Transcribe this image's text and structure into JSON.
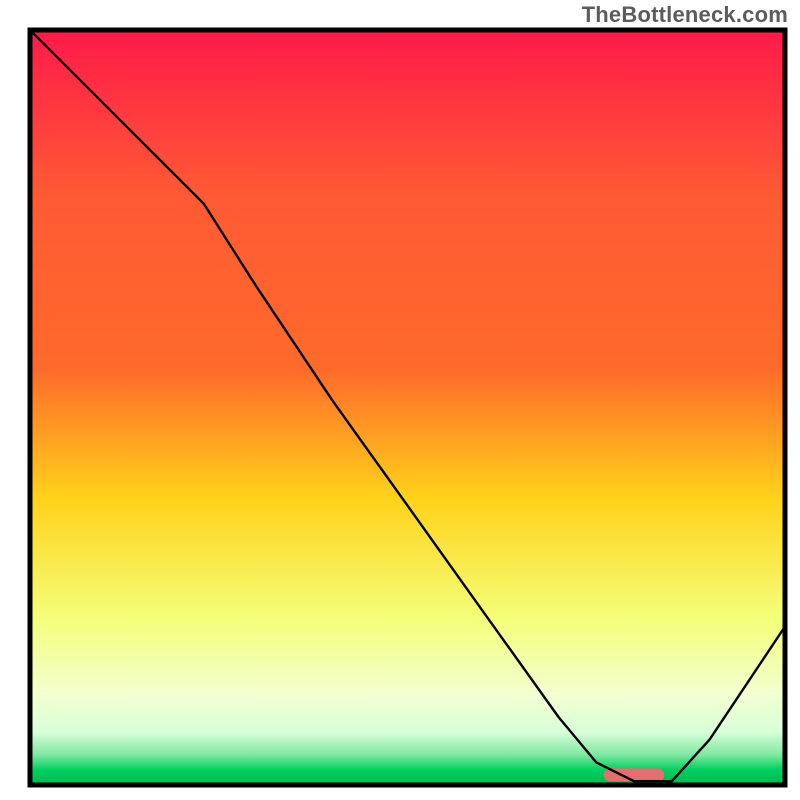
{
  "watermark": "TheBottleneck.com",
  "colors": {
    "border": "#000000",
    "curve": "#000000",
    "marker_fill": "#e17070",
    "grad_top": "#ff1a4a",
    "grad_upper": "#ff6a2a",
    "grad_mid": "#ffd21a",
    "grad_lower": "#f4ff7a",
    "grad_pale": "#f2ffd0",
    "grad_green": "#00d060",
    "grad_green2": "#00b850"
  },
  "chart_data": {
    "type": "line",
    "title": "",
    "xlabel": "",
    "ylabel": "",
    "xlim": [
      0,
      100
    ],
    "ylim": [
      0,
      100
    ],
    "x": [
      0,
      8,
      18,
      23,
      30,
      40,
      50,
      60,
      70,
      75,
      80,
      85,
      90,
      100
    ],
    "values": [
      100,
      92,
      82,
      77,
      66,
      51,
      37,
      23,
      9,
      3,
      0.5,
      0.5,
      6,
      21
    ],
    "marker": {
      "x_start": 76,
      "x_end": 84,
      "y": 1.4
    },
    "note": "Values are bottleneck-percentage read from a red→green vertical gradient; curve descends from top-left, bottoms out near x≈80, then rises. Axes carry no labels or ticks in the source image."
  }
}
